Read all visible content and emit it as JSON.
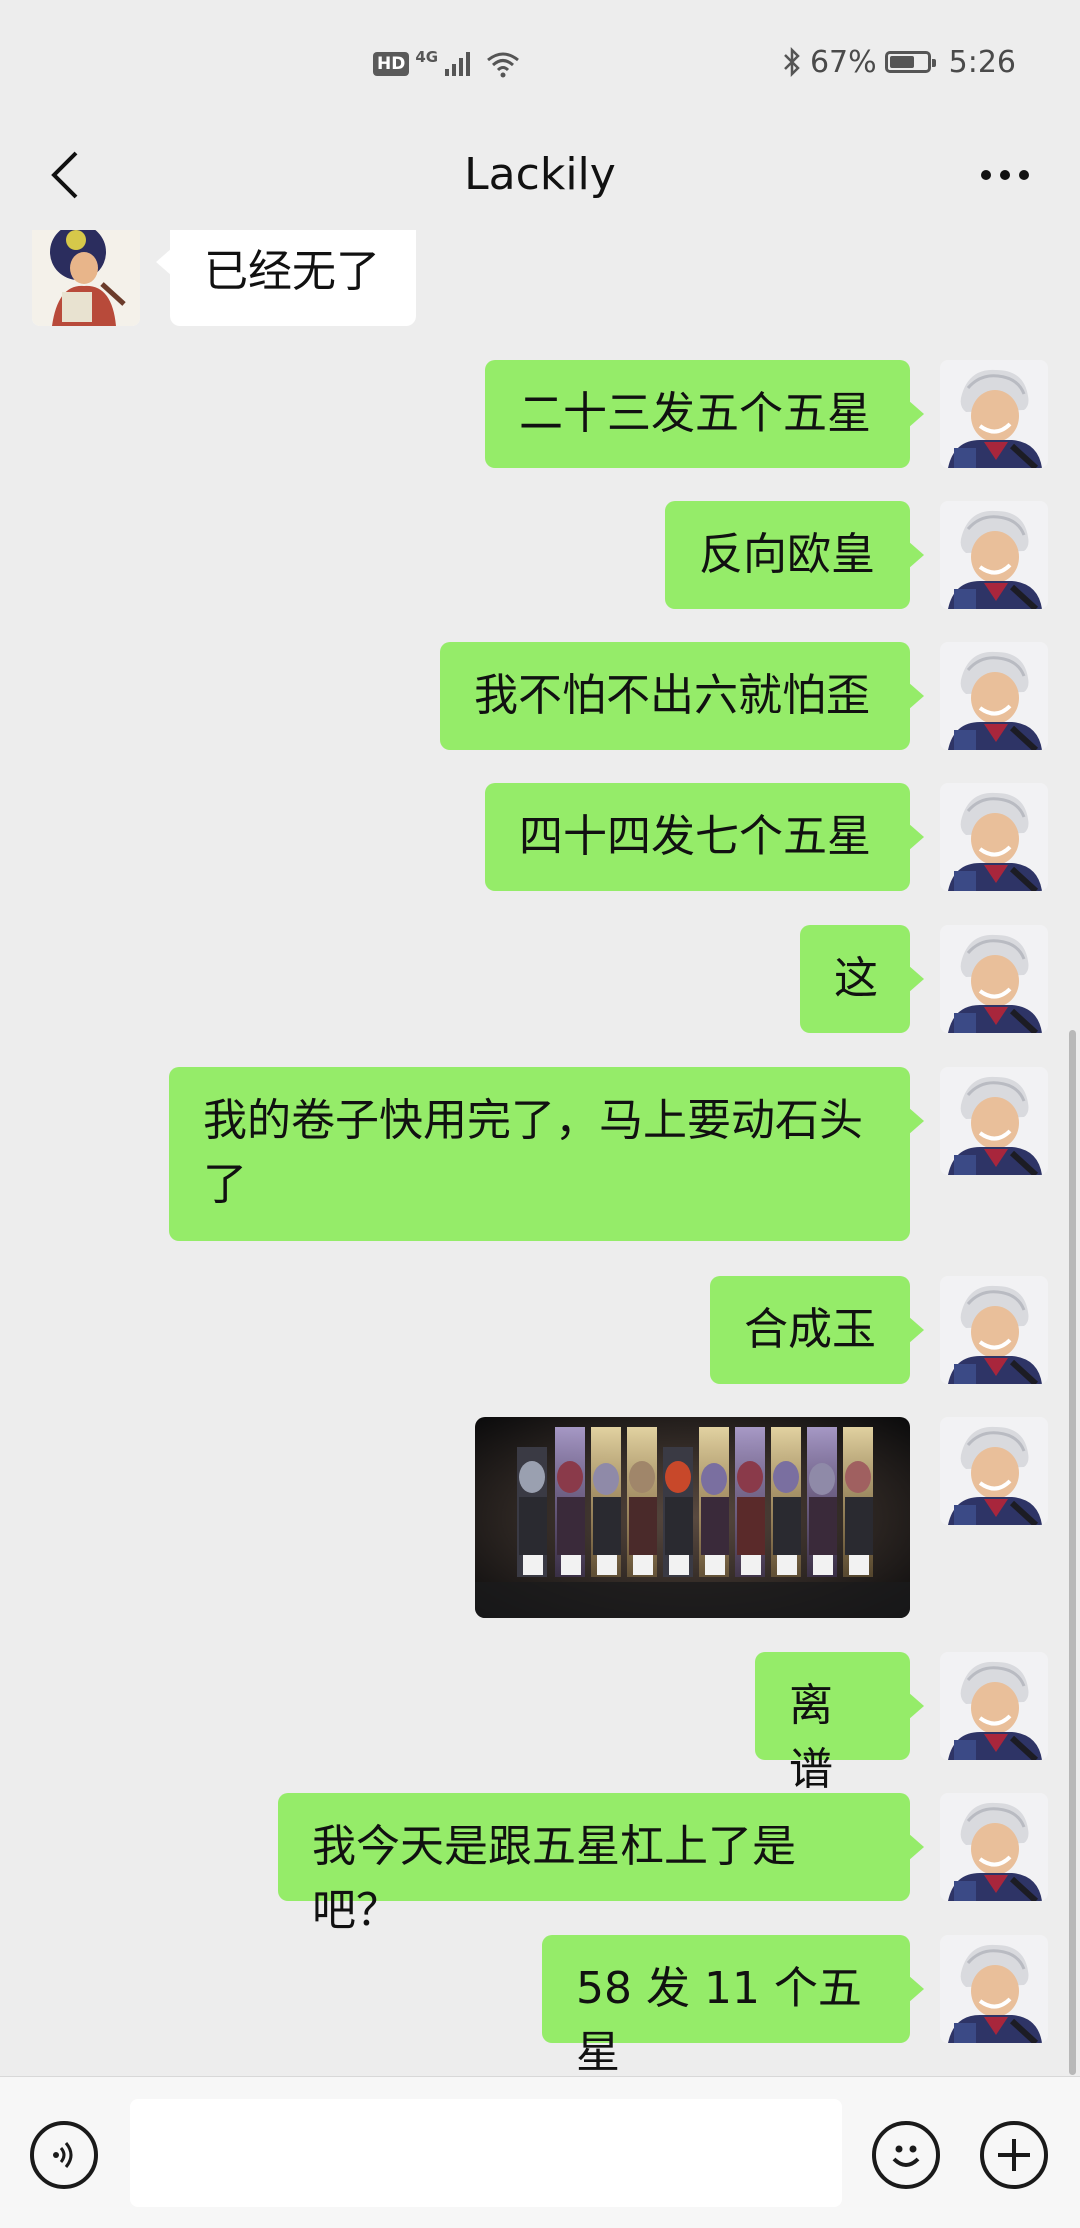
{
  "status_bar": {
    "hd_badge": "HD",
    "network": "4G",
    "battery_percent": "67%",
    "battery_level": 0.67,
    "time": "5:26"
  },
  "nav": {
    "title": "Lackily"
  },
  "messages": [
    {
      "side": "in",
      "type": "text",
      "text": "已经无了"
    },
    {
      "side": "out",
      "type": "text",
      "text": "二十三发五个五星"
    },
    {
      "side": "out",
      "type": "text",
      "text": "反向欧皇"
    },
    {
      "side": "out",
      "type": "text",
      "text": "我不怕不出六就怕歪"
    },
    {
      "side": "out",
      "type": "text",
      "text": "四十四发七个五星"
    },
    {
      "side": "out",
      "type": "text",
      "text": "这"
    },
    {
      "side": "out",
      "type": "text",
      "text": "我的卷子快用完了，马上要动石头",
      "text_line2": "了"
    },
    {
      "side": "out",
      "type": "text",
      "text": "合成玉"
    },
    {
      "side": "out",
      "type": "image",
      "alt": "ten-pull-result-screenshot"
    },
    {
      "side": "out",
      "type": "text",
      "text": "离谱"
    },
    {
      "side": "out",
      "type": "text",
      "text": "我今天是跟五星杠上了是吧？"
    },
    {
      "side": "out",
      "type": "text",
      "text": "58 发 11 个五星"
    }
  ],
  "input": {
    "value": "",
    "placeholder": ""
  },
  "colors": {
    "outgoing_bubble": "#95ec69",
    "incoming_bubble": "#ffffff",
    "background": "#ededed"
  },
  "icons": {
    "back": "chevron-left-icon",
    "more": "more-dots-icon",
    "voice": "voice-icon",
    "emoji": "emoji-icon",
    "plus": "plus-icon"
  }
}
